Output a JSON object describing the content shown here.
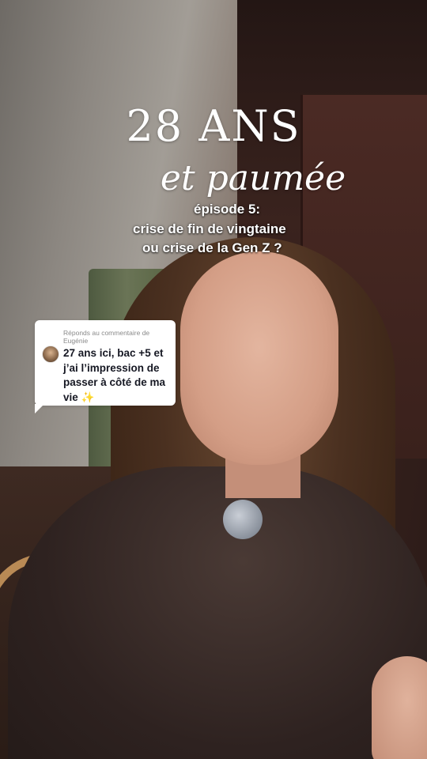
{
  "overlay": {
    "title_main": "28 ANS",
    "title_script": "et paumée",
    "episode_line1": "épisode 5:",
    "episode_line2": "crise de fin de vingtaine",
    "episode_line3": "ou crise de la Gen Z ?"
  },
  "reply": {
    "label": "Réponds au commentaire de Eugénie",
    "text": "27 ans ici, bac +5 et j’ai l’impression de passer à côté de ma vie",
    "emoji": "✨",
    "avatar_icon": "commenter-avatar"
  }
}
